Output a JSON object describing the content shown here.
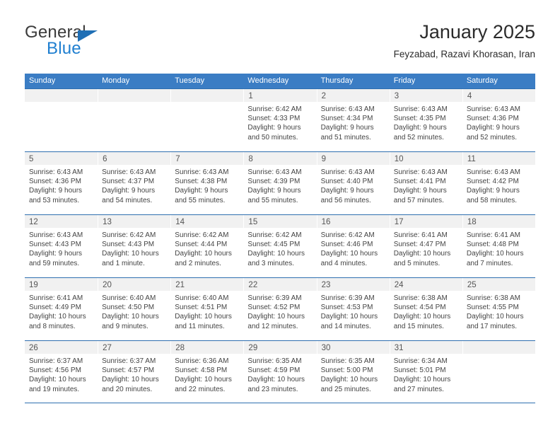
{
  "brand": {
    "line1": "General",
    "line2": "Blue",
    "accent_dark": "#3b3b3b",
    "accent_blue": "#1f7fd0",
    "triangle_color": "#1f6fb5"
  },
  "header": {
    "title": "January 2025",
    "subtitle": "Feyzabad, Razavi Khorasan, Iran"
  },
  "theme": {
    "header_row_bg": "#3b7dc4",
    "header_row_text": "#ffffff",
    "week_divider": "#2f6fb0",
    "daynum_band_bg": "#f1f1f1",
    "body_text": "#444444"
  },
  "weekdays": [
    "Sunday",
    "Monday",
    "Tuesday",
    "Wednesday",
    "Thursday",
    "Friday",
    "Saturday"
  ],
  "weeks": [
    [
      {
        "day": "",
        "empty": true
      },
      {
        "day": "",
        "empty": true
      },
      {
        "day": "",
        "empty": true
      },
      {
        "day": "1",
        "sunrise": "Sunrise: 6:42 AM",
        "sunset": "Sunset: 4:33 PM",
        "daylight1": "Daylight: 9 hours",
        "daylight2": "and 50 minutes."
      },
      {
        "day": "2",
        "sunrise": "Sunrise: 6:43 AM",
        "sunset": "Sunset: 4:34 PM",
        "daylight1": "Daylight: 9 hours",
        "daylight2": "and 51 minutes."
      },
      {
        "day": "3",
        "sunrise": "Sunrise: 6:43 AM",
        "sunset": "Sunset: 4:35 PM",
        "daylight1": "Daylight: 9 hours",
        "daylight2": "and 52 minutes."
      },
      {
        "day": "4",
        "sunrise": "Sunrise: 6:43 AM",
        "sunset": "Sunset: 4:36 PM",
        "daylight1": "Daylight: 9 hours",
        "daylight2": "and 52 minutes."
      }
    ],
    [
      {
        "day": "5",
        "sunrise": "Sunrise: 6:43 AM",
        "sunset": "Sunset: 4:36 PM",
        "daylight1": "Daylight: 9 hours",
        "daylight2": "and 53 minutes."
      },
      {
        "day": "6",
        "sunrise": "Sunrise: 6:43 AM",
        "sunset": "Sunset: 4:37 PM",
        "daylight1": "Daylight: 9 hours",
        "daylight2": "and 54 minutes."
      },
      {
        "day": "7",
        "sunrise": "Sunrise: 6:43 AM",
        "sunset": "Sunset: 4:38 PM",
        "daylight1": "Daylight: 9 hours",
        "daylight2": "and 55 minutes."
      },
      {
        "day": "8",
        "sunrise": "Sunrise: 6:43 AM",
        "sunset": "Sunset: 4:39 PM",
        "daylight1": "Daylight: 9 hours",
        "daylight2": "and 55 minutes."
      },
      {
        "day": "9",
        "sunrise": "Sunrise: 6:43 AM",
        "sunset": "Sunset: 4:40 PM",
        "daylight1": "Daylight: 9 hours",
        "daylight2": "and 56 minutes."
      },
      {
        "day": "10",
        "sunrise": "Sunrise: 6:43 AM",
        "sunset": "Sunset: 4:41 PM",
        "daylight1": "Daylight: 9 hours",
        "daylight2": "and 57 minutes."
      },
      {
        "day": "11",
        "sunrise": "Sunrise: 6:43 AM",
        "sunset": "Sunset: 4:42 PM",
        "daylight1": "Daylight: 9 hours",
        "daylight2": "and 58 minutes."
      }
    ],
    [
      {
        "day": "12",
        "sunrise": "Sunrise: 6:43 AM",
        "sunset": "Sunset: 4:43 PM",
        "daylight1": "Daylight: 9 hours",
        "daylight2": "and 59 minutes."
      },
      {
        "day": "13",
        "sunrise": "Sunrise: 6:42 AM",
        "sunset": "Sunset: 4:43 PM",
        "daylight1": "Daylight: 10 hours",
        "daylight2": "and 1 minute."
      },
      {
        "day": "14",
        "sunrise": "Sunrise: 6:42 AM",
        "sunset": "Sunset: 4:44 PM",
        "daylight1": "Daylight: 10 hours",
        "daylight2": "and 2 minutes."
      },
      {
        "day": "15",
        "sunrise": "Sunrise: 6:42 AM",
        "sunset": "Sunset: 4:45 PM",
        "daylight1": "Daylight: 10 hours",
        "daylight2": "and 3 minutes."
      },
      {
        "day": "16",
        "sunrise": "Sunrise: 6:42 AM",
        "sunset": "Sunset: 4:46 PM",
        "daylight1": "Daylight: 10 hours",
        "daylight2": "and 4 minutes."
      },
      {
        "day": "17",
        "sunrise": "Sunrise: 6:41 AM",
        "sunset": "Sunset: 4:47 PM",
        "daylight1": "Daylight: 10 hours",
        "daylight2": "and 5 minutes."
      },
      {
        "day": "18",
        "sunrise": "Sunrise: 6:41 AM",
        "sunset": "Sunset: 4:48 PM",
        "daylight1": "Daylight: 10 hours",
        "daylight2": "and 7 minutes."
      }
    ],
    [
      {
        "day": "19",
        "sunrise": "Sunrise: 6:41 AM",
        "sunset": "Sunset: 4:49 PM",
        "daylight1": "Daylight: 10 hours",
        "daylight2": "and 8 minutes."
      },
      {
        "day": "20",
        "sunrise": "Sunrise: 6:40 AM",
        "sunset": "Sunset: 4:50 PM",
        "daylight1": "Daylight: 10 hours",
        "daylight2": "and 9 minutes."
      },
      {
        "day": "21",
        "sunrise": "Sunrise: 6:40 AM",
        "sunset": "Sunset: 4:51 PM",
        "daylight1": "Daylight: 10 hours",
        "daylight2": "and 11 minutes."
      },
      {
        "day": "22",
        "sunrise": "Sunrise: 6:39 AM",
        "sunset": "Sunset: 4:52 PM",
        "daylight1": "Daylight: 10 hours",
        "daylight2": "and 12 minutes."
      },
      {
        "day": "23",
        "sunrise": "Sunrise: 6:39 AM",
        "sunset": "Sunset: 4:53 PM",
        "daylight1": "Daylight: 10 hours",
        "daylight2": "and 14 minutes."
      },
      {
        "day": "24",
        "sunrise": "Sunrise: 6:38 AM",
        "sunset": "Sunset: 4:54 PM",
        "daylight1": "Daylight: 10 hours",
        "daylight2": "and 15 minutes."
      },
      {
        "day": "25",
        "sunrise": "Sunrise: 6:38 AM",
        "sunset": "Sunset: 4:55 PM",
        "daylight1": "Daylight: 10 hours",
        "daylight2": "and 17 minutes."
      }
    ],
    [
      {
        "day": "26",
        "sunrise": "Sunrise: 6:37 AM",
        "sunset": "Sunset: 4:56 PM",
        "daylight1": "Daylight: 10 hours",
        "daylight2": "and 19 minutes."
      },
      {
        "day": "27",
        "sunrise": "Sunrise: 6:37 AM",
        "sunset": "Sunset: 4:57 PM",
        "daylight1": "Daylight: 10 hours",
        "daylight2": "and 20 minutes."
      },
      {
        "day": "28",
        "sunrise": "Sunrise: 6:36 AM",
        "sunset": "Sunset: 4:58 PM",
        "daylight1": "Daylight: 10 hours",
        "daylight2": "and 22 minutes."
      },
      {
        "day": "29",
        "sunrise": "Sunrise: 6:35 AM",
        "sunset": "Sunset: 4:59 PM",
        "daylight1": "Daylight: 10 hours",
        "daylight2": "and 23 minutes."
      },
      {
        "day": "30",
        "sunrise": "Sunrise: 6:35 AM",
        "sunset": "Sunset: 5:00 PM",
        "daylight1": "Daylight: 10 hours",
        "daylight2": "and 25 minutes."
      },
      {
        "day": "31",
        "sunrise": "Sunrise: 6:34 AM",
        "sunset": "Sunset: 5:01 PM",
        "daylight1": "Daylight: 10 hours",
        "daylight2": "and 27 minutes."
      },
      {
        "day": "",
        "empty": true
      }
    ]
  ]
}
